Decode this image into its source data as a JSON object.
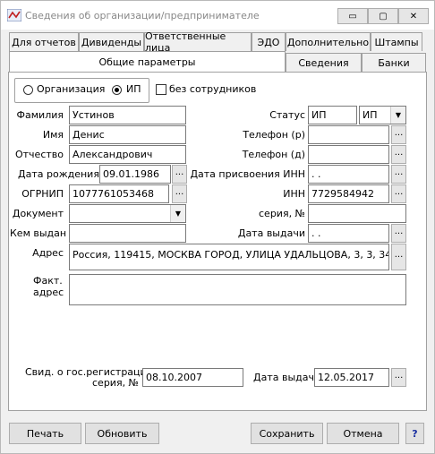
{
  "window": {
    "title": "Сведения об организации/предпринимателе",
    "minimize": "▭",
    "maximize": "▢",
    "close": "✕"
  },
  "tabs_row1": [
    "Для отчетов",
    "Дивиденды",
    "Ответственные лица",
    "ЭДО",
    "Дополнительно",
    "Штампы"
  ],
  "tabs_row2": [
    "Общие параметры",
    "Сведения",
    "Банки"
  ],
  "type": {
    "org": "Организация",
    "ip": "ИП",
    "no_staff": "без сотрудников",
    "selected": "ИП"
  },
  "fields": {
    "familiya": {
      "label": "Фамилия",
      "value": "Устинов"
    },
    "imya": {
      "label": "Имя",
      "value": "Денис"
    },
    "otchestvo": {
      "label": "Отчество",
      "value": "Александрович"
    },
    "birth": {
      "label": "Дата рождения",
      "value": "09.01.1986"
    },
    "ogrnip": {
      "label": "ОГРНИП",
      "value": "1077761053468"
    },
    "document": {
      "label": "Документ",
      "value": ""
    },
    "issued_by": {
      "label": "Кем выдан",
      "value": ""
    },
    "address": {
      "label": "Адрес",
      "value": "Россия, 119415, МОСКВА ГОРОД,  УЛИЦА УДАЛЬЦОВА,  3,  3,  34"
    },
    "fact_address": {
      "label1": "Факт.",
      "label2": "адрес",
      "value": ""
    },
    "status": {
      "label": "Статус",
      "value1": "ИП",
      "value2": "ИП"
    },
    "phone_r": {
      "label": "Телефон (р)",
      "value": ""
    },
    "phone_d": {
      "label": "Телефон (д)",
      "value": ""
    },
    "inn_date": {
      "label": "Дата присвоения ИНН",
      "value": "  .  ."
    },
    "inn": {
      "label": "ИНН",
      "value": "7729584942"
    },
    "series": {
      "label": "серия, №",
      "value": ""
    },
    "issue_date": {
      "label": "Дата выдачи",
      "value": "  .  ."
    },
    "reg_cert": {
      "label1": "Свид. о гос.регистрации:",
      "label2": "серия, №",
      "value": "08.10.2007"
    },
    "reg_issue_date": {
      "label": "Дата выдачи",
      "value": "12.05.2017"
    }
  },
  "ellipsis": "...",
  "dropdown_arrow": "▼",
  "buttons": {
    "print": "Печать",
    "refresh": "Обновить",
    "save": "Сохранить",
    "cancel": "Отмена",
    "help": "?"
  }
}
